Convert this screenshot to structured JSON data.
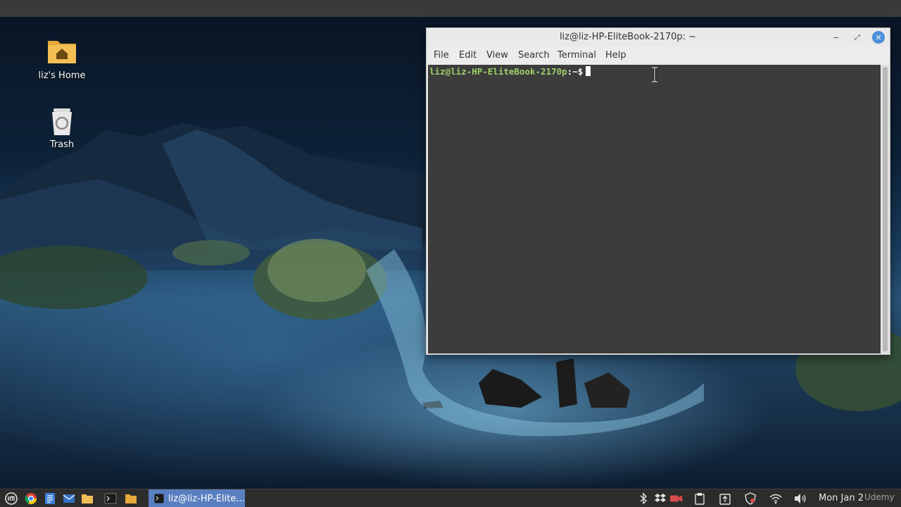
{
  "desktop": {
    "icons": [
      {
        "label": "liz's Home",
        "icon": "home-folder-icon"
      },
      {
        "label": "Trash",
        "icon": "trash-icon"
      }
    ]
  },
  "terminal": {
    "title": "liz@liz-HP-EliteBook-2170p: ~",
    "menu": [
      "File",
      "Edit",
      "View",
      "Search",
      "Terminal",
      "Help"
    ],
    "prompt_user": "liz@liz-HP-EliteBook-2170p",
    "prompt_path": ":~$",
    "colors": {
      "background": "#3c3c3c",
      "prompt_user": "#9bd16a",
      "close_button": "#4a8fd9"
    }
  },
  "taskbar": {
    "launchers": [
      "mint-menu-icon",
      "chrome-icon",
      "text-editor-icon",
      "mail-icon",
      "files-icon",
      "terminal-icon",
      "folder-icon"
    ],
    "active_task": "liz@liz-HP-Elite...",
    "tray": [
      "bluetooth-icon",
      "dropbox-icon",
      "camera-icon",
      "clipboard-icon",
      "update-icon",
      "shield-icon",
      "wifi-icon",
      "volume-icon"
    ],
    "clock": "Mon Jan 2",
    "watermark": "Udemy",
    "accent": "#5a7fc0"
  }
}
